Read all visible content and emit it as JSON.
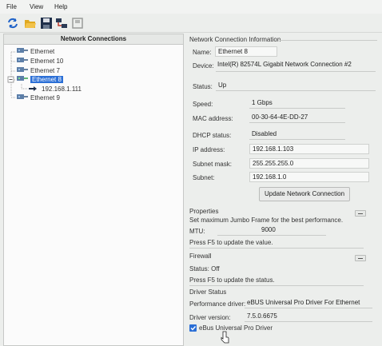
{
  "menu": {
    "file": "File",
    "view": "View",
    "help": "Help"
  },
  "toolbar": {
    "icons": [
      "refresh-icon",
      "open-folder-icon",
      "save-icon",
      "network-icon",
      "disabled-icon"
    ]
  },
  "left_pane": {
    "header": "Network Connections",
    "items": [
      {
        "label": "Ethernet"
      },
      {
        "label": "Ethernet 10"
      },
      {
        "label": "Ethernet 7"
      },
      {
        "label": "Ethernet 8"
      },
      {
        "label": "192.168.1.111"
      },
      {
        "label": "Ethernet 9"
      }
    ]
  },
  "info": {
    "title": "Network Connection Information",
    "name_label": "Name:",
    "name_value": "Ethernet 8",
    "device_label": "Device:",
    "device_value": "Intel(R) 82574L Gigabit Network Connection #2",
    "status_label": "Status:",
    "status_value": "Up",
    "speed_label": "Speed:",
    "speed_value": "1 Gbps",
    "mac_label": "MAC address:",
    "mac_value": "00-30-64-4E-DD-27",
    "dhcp_label": "DHCP status:",
    "dhcp_value": "Disabled",
    "ip_label": "IP address:",
    "ip_value": "192.168.1.103",
    "mask_label": "Subnet mask:",
    "mask_value": "255.255.255.0",
    "subnet_label": "Subnet:",
    "subnet_value": "192.168.1.0",
    "update_button": "Update Network Connection"
  },
  "properties": {
    "title": "Properties",
    "desc": "Set maximum Jumbo Frame for the best performance.",
    "mtu_label": "MTU:",
    "mtu_value": "9000",
    "hint": "Press F5 to update the value."
  },
  "firewall": {
    "title": "Firewall",
    "status": "Status:  Off",
    "hint": "Press F5 to update the status."
  },
  "driver": {
    "title": "Driver Status",
    "perf_label": "Performance driver:",
    "perf_value": "eBUS Universal Pro Driver For Ethernet",
    "version_label": "Driver version:",
    "version_value": "7.5.0.6675",
    "checkbox_label": "eBus Universal Pro Driver",
    "checkbox_checked": true
  },
  "colors": {
    "selection": "#2b6fd6",
    "background": "#eceeec"
  }
}
